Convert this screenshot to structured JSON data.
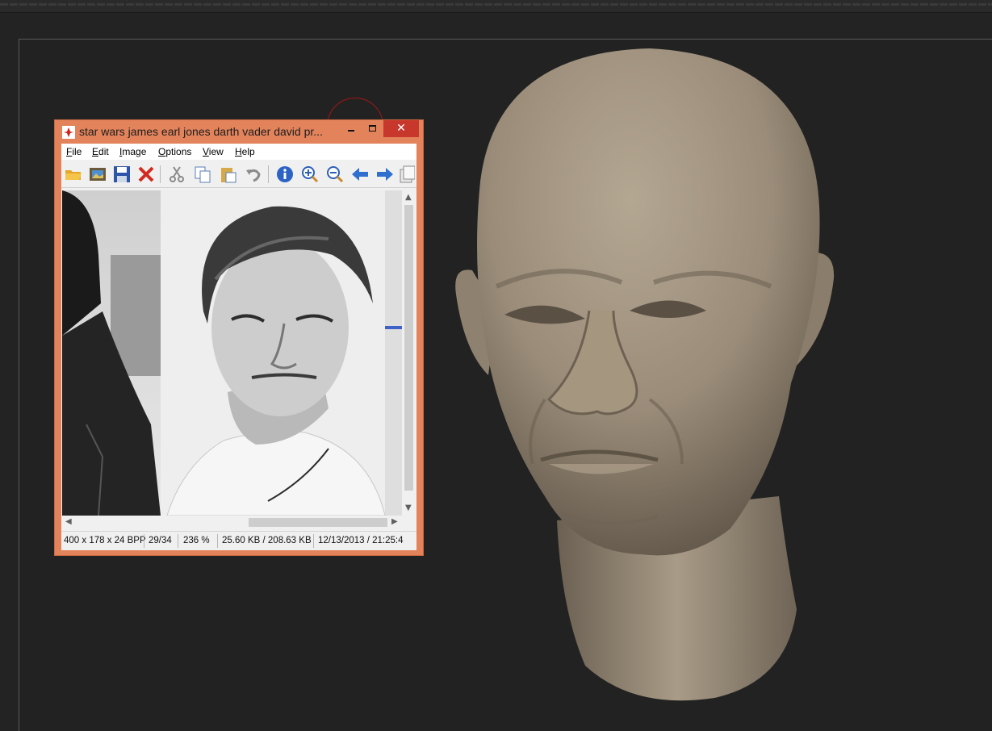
{
  "window": {
    "title": "star wars james earl jones darth vader david pr...",
    "close_glyph": "✕"
  },
  "menu": [
    "File",
    "Edit",
    "Image",
    "Options",
    "View",
    "Help"
  ],
  "toolbar_icons": [
    "open-folder-icon",
    "slideshow-icon",
    "save-icon",
    "delete-icon",
    "cut-icon",
    "copy-icon",
    "paste-icon",
    "undo-icon",
    "info-icon",
    "zoom-in-icon",
    "zoom-out-icon",
    "previous-arrow-icon",
    "next-arrow-icon",
    "copy-to-icon"
  ],
  "status": {
    "dimensions": "400 x 178 x 24 BPP",
    "index": "29/34",
    "zoom": "236 %",
    "size": "25.60 KB / 208.63 KB",
    "datetime": "12/13/2013 / 21:25:4"
  },
  "colors": {
    "title_bar": "#e2835c",
    "close_button": "#c7372c",
    "viewport_bg": "#232323",
    "clay": "#9e917f"
  }
}
